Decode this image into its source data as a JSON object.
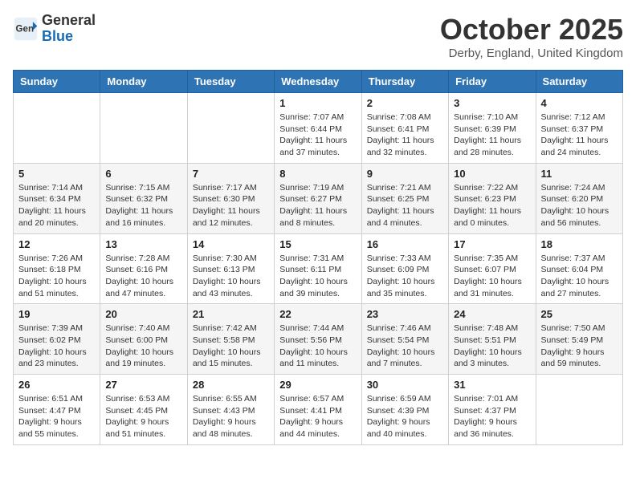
{
  "header": {
    "logo_general": "General",
    "logo_blue": "Blue",
    "month": "October 2025",
    "location": "Derby, England, United Kingdom"
  },
  "weekdays": [
    "Sunday",
    "Monday",
    "Tuesday",
    "Wednesday",
    "Thursday",
    "Friday",
    "Saturday"
  ],
  "weeks": [
    [
      {
        "day": "",
        "info": ""
      },
      {
        "day": "",
        "info": ""
      },
      {
        "day": "",
        "info": ""
      },
      {
        "day": "1",
        "info": "Sunrise: 7:07 AM\nSunset: 6:44 PM\nDaylight: 11 hours and 37 minutes."
      },
      {
        "day": "2",
        "info": "Sunrise: 7:08 AM\nSunset: 6:41 PM\nDaylight: 11 hours and 32 minutes."
      },
      {
        "day": "3",
        "info": "Sunrise: 7:10 AM\nSunset: 6:39 PM\nDaylight: 11 hours and 28 minutes."
      },
      {
        "day": "4",
        "info": "Sunrise: 7:12 AM\nSunset: 6:37 PM\nDaylight: 11 hours and 24 minutes."
      }
    ],
    [
      {
        "day": "5",
        "info": "Sunrise: 7:14 AM\nSunset: 6:34 PM\nDaylight: 11 hours and 20 minutes."
      },
      {
        "day": "6",
        "info": "Sunrise: 7:15 AM\nSunset: 6:32 PM\nDaylight: 11 hours and 16 minutes."
      },
      {
        "day": "7",
        "info": "Sunrise: 7:17 AM\nSunset: 6:30 PM\nDaylight: 11 hours and 12 minutes."
      },
      {
        "day": "8",
        "info": "Sunrise: 7:19 AM\nSunset: 6:27 PM\nDaylight: 11 hours and 8 minutes."
      },
      {
        "day": "9",
        "info": "Sunrise: 7:21 AM\nSunset: 6:25 PM\nDaylight: 11 hours and 4 minutes."
      },
      {
        "day": "10",
        "info": "Sunrise: 7:22 AM\nSunset: 6:23 PM\nDaylight: 11 hours and 0 minutes."
      },
      {
        "day": "11",
        "info": "Sunrise: 7:24 AM\nSunset: 6:20 PM\nDaylight: 10 hours and 56 minutes."
      }
    ],
    [
      {
        "day": "12",
        "info": "Sunrise: 7:26 AM\nSunset: 6:18 PM\nDaylight: 10 hours and 51 minutes."
      },
      {
        "day": "13",
        "info": "Sunrise: 7:28 AM\nSunset: 6:16 PM\nDaylight: 10 hours and 47 minutes."
      },
      {
        "day": "14",
        "info": "Sunrise: 7:30 AM\nSunset: 6:13 PM\nDaylight: 10 hours and 43 minutes."
      },
      {
        "day": "15",
        "info": "Sunrise: 7:31 AM\nSunset: 6:11 PM\nDaylight: 10 hours and 39 minutes."
      },
      {
        "day": "16",
        "info": "Sunrise: 7:33 AM\nSunset: 6:09 PM\nDaylight: 10 hours and 35 minutes."
      },
      {
        "day": "17",
        "info": "Sunrise: 7:35 AM\nSunset: 6:07 PM\nDaylight: 10 hours and 31 minutes."
      },
      {
        "day": "18",
        "info": "Sunrise: 7:37 AM\nSunset: 6:04 PM\nDaylight: 10 hours and 27 minutes."
      }
    ],
    [
      {
        "day": "19",
        "info": "Sunrise: 7:39 AM\nSunset: 6:02 PM\nDaylight: 10 hours and 23 minutes."
      },
      {
        "day": "20",
        "info": "Sunrise: 7:40 AM\nSunset: 6:00 PM\nDaylight: 10 hours and 19 minutes."
      },
      {
        "day": "21",
        "info": "Sunrise: 7:42 AM\nSunset: 5:58 PM\nDaylight: 10 hours and 15 minutes."
      },
      {
        "day": "22",
        "info": "Sunrise: 7:44 AM\nSunset: 5:56 PM\nDaylight: 10 hours and 11 minutes."
      },
      {
        "day": "23",
        "info": "Sunrise: 7:46 AM\nSunset: 5:54 PM\nDaylight: 10 hours and 7 minutes."
      },
      {
        "day": "24",
        "info": "Sunrise: 7:48 AM\nSunset: 5:51 PM\nDaylight: 10 hours and 3 minutes."
      },
      {
        "day": "25",
        "info": "Sunrise: 7:50 AM\nSunset: 5:49 PM\nDaylight: 9 hours and 59 minutes."
      }
    ],
    [
      {
        "day": "26",
        "info": "Sunrise: 6:51 AM\nSunset: 4:47 PM\nDaylight: 9 hours and 55 minutes."
      },
      {
        "day": "27",
        "info": "Sunrise: 6:53 AM\nSunset: 4:45 PM\nDaylight: 9 hours and 51 minutes."
      },
      {
        "day": "28",
        "info": "Sunrise: 6:55 AM\nSunset: 4:43 PM\nDaylight: 9 hours and 48 minutes."
      },
      {
        "day": "29",
        "info": "Sunrise: 6:57 AM\nSunset: 4:41 PM\nDaylight: 9 hours and 44 minutes."
      },
      {
        "day": "30",
        "info": "Sunrise: 6:59 AM\nSunset: 4:39 PM\nDaylight: 9 hours and 40 minutes."
      },
      {
        "day": "31",
        "info": "Sunrise: 7:01 AM\nSunset: 4:37 PM\nDaylight: 9 hours and 36 minutes."
      },
      {
        "day": "",
        "info": ""
      }
    ]
  ]
}
